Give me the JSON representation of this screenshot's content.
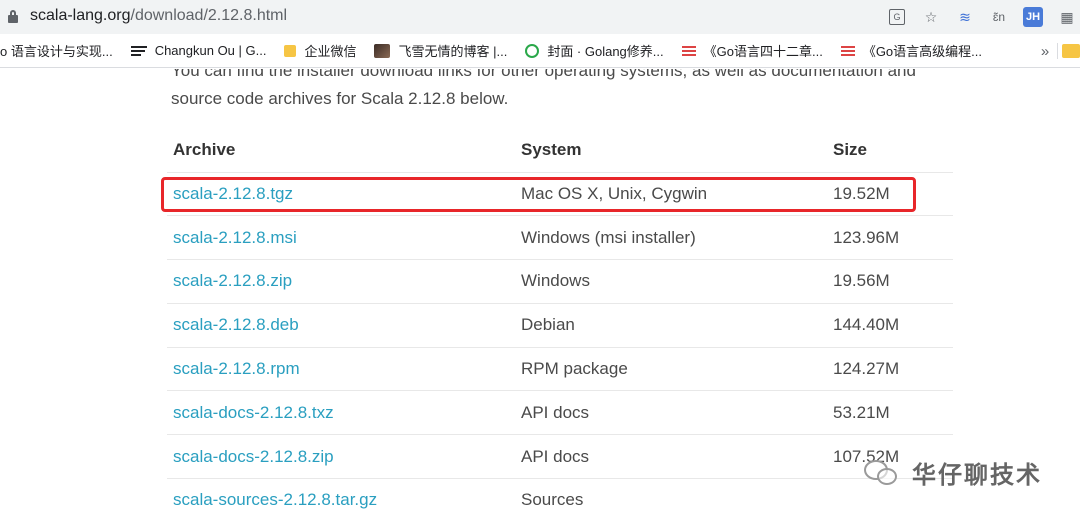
{
  "browser": {
    "url_host": "scala-lang.org",
    "url_path": "/download/2.12.8.html",
    "extension_jh": "JH",
    "bookmarks": [
      {
        "label": "o 语言设计与实现...",
        "icon": "none"
      },
      {
        "label": "Changkun Ou | G...",
        "icon": "lines-icon"
      },
      {
        "label": "企业微信",
        "icon": "folder-icon"
      },
      {
        "label": "飞雪无情的博客 |...",
        "icon": "avatar-icon"
      },
      {
        "label": "封面 · Golang修养...",
        "icon": "green-circle-icon"
      },
      {
        "label": "《Go语言四十二章...",
        "icon": "red-stack-icon"
      },
      {
        "label": "《Go语言高级编程...",
        "icon": "red-stack-icon"
      }
    ],
    "bookmarks_more": "»"
  },
  "page": {
    "intro_line1": "You can find the installer download links for other operating systems, as well as documentation and",
    "intro_line2": "source code archives for Scala 2.12.8 below.",
    "table": {
      "headers": {
        "archive": "Archive",
        "system": "System",
        "size": "Size"
      },
      "rows": [
        {
          "archive": "scala-2.12.8.tgz",
          "system": "Mac OS X, Unix, Cygwin",
          "size": "19.52M"
        },
        {
          "archive": "scala-2.12.8.msi",
          "system": "Windows (msi installer)",
          "size": "123.96M"
        },
        {
          "archive": "scala-2.12.8.zip",
          "system": "Windows",
          "size": "19.56M"
        },
        {
          "archive": "scala-2.12.8.deb",
          "system": "Debian",
          "size": "144.40M"
        },
        {
          "archive": "scala-2.12.8.rpm",
          "system": "RPM package",
          "size": "124.27M"
        },
        {
          "archive": "scala-docs-2.12.8.txz",
          "system": "API docs",
          "size": "53.21M"
        },
        {
          "archive": "scala-docs-2.12.8.zip",
          "system": "API docs",
          "size": "107.52M"
        },
        {
          "archive": "scala-sources-2.12.8.tar.gz",
          "system": "Sources",
          "size": ""
        }
      ]
    }
  },
  "watermark": {
    "text": "华仔聊技术"
  },
  "colors": {
    "link": "#2a9fc0",
    "highlight": "#e8262a"
  }
}
